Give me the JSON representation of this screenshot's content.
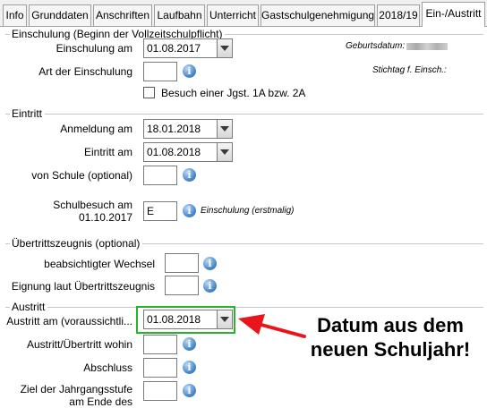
{
  "tabs": [
    {
      "label": "Info",
      "active": false
    },
    {
      "label": "Grunddaten",
      "active": false
    },
    {
      "label": "Anschriften",
      "active": false
    },
    {
      "label": "Laufbahn",
      "active": false
    },
    {
      "label": "Unterricht",
      "active": false
    },
    {
      "label": "Gastschulgenehmigung",
      "active": false
    },
    {
      "label": "2018/19",
      "active": false
    },
    {
      "label": "Ein-/Austritt",
      "active": true
    }
  ],
  "einschulung": {
    "group_title": "Einschulung (Beginn der Vollzeitschulpflicht)",
    "einschulung_am_label": "Einschulung am",
    "einschulung_am_value": "01.08.2017",
    "art_label": "Art der Einschulung",
    "art_value": "",
    "besuch_label": "Besuch einer Jgst. 1A bzw. 2A",
    "besuch_checked": false,
    "geburtsdatum_label": "Geburtsdatum:",
    "stichtag_label": "Stichtag f. Einsch.:"
  },
  "eintritt": {
    "group_title": "Eintritt",
    "anmeldung_label": "Anmeldung am",
    "anmeldung_value": "18.01.2018",
    "eintritt_label": "Eintritt am",
    "eintritt_value": "01.08.2018",
    "von_schule_label": "von Schule (optional)",
    "von_schule_value": "",
    "schulbesuch_label_line1": "Schulbesuch am",
    "schulbesuch_label_line2": "01.10.2017",
    "schulbesuch_value": "E",
    "schulbesuch_note": "Einschulung (erstmalig)"
  },
  "uebertritt": {
    "group_title": "Übertrittszeugnis (optional)",
    "wechsel_label": "beabsichtigter Wechsel",
    "wechsel_value": "",
    "eignung_label": "Eignung laut Übertrittszeugnis",
    "eignung_value": ""
  },
  "austritt": {
    "group_title": "Austritt",
    "austritt_am_label": "Austritt am (voraussichtli...",
    "austritt_am_value": "01.08.2018",
    "wohin_label": "Austritt/Übertritt wohin",
    "wohin_value": "",
    "abschluss_label": "Abschluss",
    "abschluss_value": "",
    "ziel_label_line1": "Ziel der Jahrgangsstufe",
    "ziel_label_line2": "am Ende des",
    "ziel_value": ""
  },
  "annotation": {
    "line1": "Datum aus dem",
    "line2": "neuen Schuljahr!",
    "arrow_color": "#e8151b",
    "highlight_color": "#28b428"
  }
}
